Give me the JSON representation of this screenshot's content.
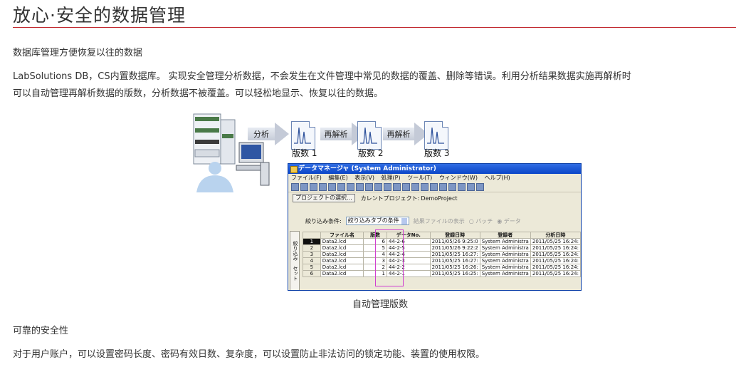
{
  "title": "放心·安全的数据管理",
  "section1": {
    "heading": "数据库管理方便恢复以往的数据",
    "paragraph_line1": "LabSolutions DB，CS内置数据库。  实现安全管理分析数据，不会发生在文件管理中常见的数据的覆盖、删除等错误。利用分析结果数据实施再解析时",
    "paragraph_line2": "可以自动管理再解析数据的版数，分析数据不被覆盖。可以轻松地显示、恢复以往的数据。"
  },
  "figure": {
    "flow": {
      "arrows": [
        "分析",
        "再解析",
        "再解析"
      ],
      "versions": [
        "版数 1",
        "版数 2",
        "版数 3"
      ]
    },
    "window": {
      "title": "データマネージャ (System Administrator)",
      "menu": [
        "ファイル(F)",
        "編集(E)",
        "表示(V)",
        "処理(P)",
        "ツール(T)",
        "ウィンドウ(W)",
        "ヘルプ(H)"
      ],
      "project_button": "プロジェクトの選択...",
      "current_project_label": "カレントプロジェクト:",
      "current_project_value": "DemoProject",
      "filter_label": "絞り込み条件:",
      "filter_value": "絞り込みタブの条件",
      "result_display_label": "結果ファイルの表示",
      "radio_batch": "バッチ",
      "radio_data": "データ",
      "side_tabs": [
        "絞り込み",
        "セット"
      ],
      "columns": [
        "",
        "ファイル名",
        "版数",
        "データNo.",
        "登録日時",
        "登録者",
        "分析日時"
      ],
      "rows": [
        [
          "1",
          "Data2.lcd",
          "6",
          "44-2-6",
          "2011/05/26 9:25:0",
          "System Administra",
          "2011/05/25 16:24:"
        ],
        [
          "2",
          "Data2.lcd",
          "5",
          "44-2-5",
          "2011/05/26 9:22:2",
          "System Administra",
          "2011/05/25 16:24:"
        ],
        [
          "3",
          "Data2.lcd",
          "4",
          "44-2-4",
          "2011/05/25 16:27:",
          "System Administra",
          "2011/05/25 16:24:"
        ],
        [
          "4",
          "Data2.lcd",
          "3",
          "44-2-3",
          "2011/05/25 16:27:",
          "System Administra",
          "2011/05/25 16:24:"
        ],
        [
          "5",
          "Data2.lcd",
          "2",
          "44-2-2",
          "2011/05/25 16:26:",
          "System Administra",
          "2011/05/25 16:24:"
        ],
        [
          "6",
          "Data2.lcd",
          "1",
          "44-2-1",
          "2011/05/25 16:25:",
          "System Administra",
          "2011/05/25 16:24:"
        ]
      ]
    },
    "caption": "自动管理版数"
  },
  "section2": {
    "heading": "可靠的安全性",
    "paragraph": "对于用户账户，可以设置密码长度、密码有效日数、复杂度，可以设置防止非法访问的锁定功能、装置的使用权限。"
  },
  "colors": {
    "accent_rule": "#c1272d",
    "highlight_box": "#d13fd0",
    "titlebar": "#0b46c8"
  }
}
